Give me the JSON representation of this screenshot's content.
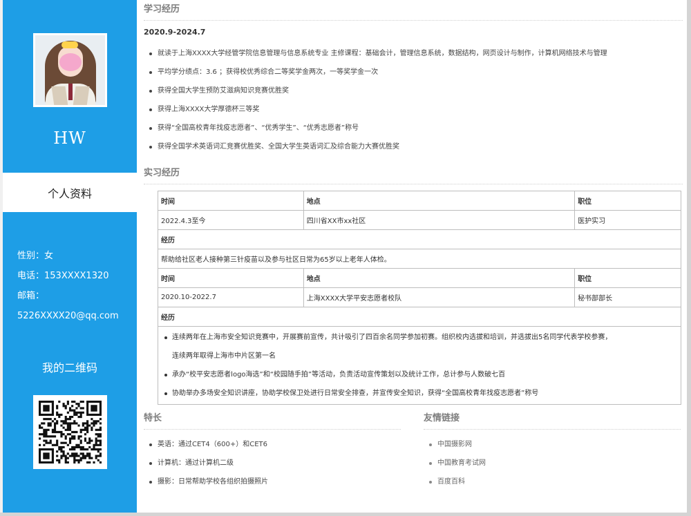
{
  "profile": {
    "name": "HW",
    "tab_label": "个人资料",
    "gender": "性别：女",
    "phone": "电话：153XXXX1320",
    "email_label": "邮箱：",
    "email": "5226XXXX20@qq.com",
    "qr_title": "我的二维码"
  },
  "education": {
    "title": "学习经历",
    "date": "2020.9-2024.7",
    "items": [
      "就读于上海XXXX大学经管学院信息管理与信息系统专业 主修课程：基础会计，管理信息系统，数据结构，网页设计与制作，计算机网络技术与管理",
      "平均学分绩点：3.6 ；获得校优秀综合二等奖学金两次，一等奖学金一次",
      "获得全国大学生预防艾滋病知识竞赛优胜奖",
      "获得上海XXXX大学厚德杯三等奖",
      "获得“全国高校青年找疫志愿者”、“优秀学生”、“优秀志愿者”称号",
      "获得全国学术英语词汇竞赛优胜奖、全国大学生英语词汇及综合能力大赛优胜奖"
    ]
  },
  "internship": {
    "title": "实习经历",
    "headers": {
      "time": "时间",
      "place": "地点",
      "role": "职位",
      "experience": "经历"
    },
    "entries": [
      {
        "time": "2022.4.3至今",
        "place": "四川省XX市xx社区",
        "role": "医护实习",
        "lines": [
          "帮助给社区老人接种第三针疫苗以及参与社区日常为65岁以上老年人体检。"
        ]
      },
      {
        "time": "2020.10-2022.7",
        "place": "上海XXXX大学平安志愿者校队",
        "role": "秘书部部长",
        "bullets": [
          "连续两年在上海市安全知识竞赛中，开展赛前宣传，共计吸引了四百余名同学参加初赛。组织校内选拔和培训，并选拔出5名同学代表学校参赛，",
          "连续两年取得上海市中片区第一名",
          "承办“校平安志愿者logo海选”和“校园随手拍”等活动，负责活动宣传策划以及统计工作，总计参与人数破七百",
          "协助举办多场安全知识讲座，协助学校保卫处进行日常安全排查，并宣传安全知识，获得“全国高校青年找疫志愿者”称号"
        ]
      }
    ]
  },
  "skills": {
    "title": "特长",
    "items": [
      "英语：通过CET4（600+）和CET6",
      "计算机：通过计算机二级",
      "摄影：日常帮助学校各组织拍摄照片"
    ]
  },
  "links": {
    "title": "友情链接",
    "items": [
      "中国摄影网",
      "中国教育考试网",
      "百度百科"
    ]
  }
}
